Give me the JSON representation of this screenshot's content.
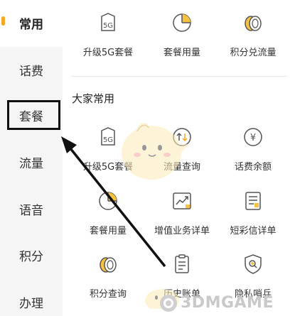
{
  "sidebar": {
    "items": [
      {
        "label": "常用",
        "active": true
      },
      {
        "label": "话费"
      },
      {
        "label": "套餐",
        "highlighted": true
      },
      {
        "label": "流量"
      },
      {
        "label": "语音"
      },
      {
        "label": "积分"
      },
      {
        "label": "办理"
      }
    ],
    "active_color": "#f5a623"
  },
  "top_row": [
    {
      "label": "升级5G套餐",
      "icon": "5g-icon"
    },
    {
      "label": "套餐用量",
      "icon": "pie-chart-icon"
    },
    {
      "label": "积分兑流量",
      "icon": "coins-icon"
    }
  ],
  "section": {
    "title": "大家常用",
    "items": [
      {
        "label": "升级5G套餐",
        "icon": "5g-icon"
      },
      {
        "label": "流量查询",
        "icon": "data-refresh-icon"
      },
      {
        "label": "话费余额",
        "icon": "yen-coin-icon"
      },
      {
        "label": "套餐用量",
        "icon": "pie-chart-icon"
      },
      {
        "label": "增值业务详单",
        "icon": "trend-chart-icon"
      },
      {
        "label": "短彩信详单",
        "icon": "message-list-icon"
      },
      {
        "label": "积分查询",
        "icon": "coins-icon"
      },
      {
        "label": "历史账单",
        "icon": "clipboard-icon"
      },
      {
        "label": "隐私哨兵",
        "icon": "shield-search-icon"
      }
    ]
  },
  "watermark": {
    "text": "3DMGAME"
  }
}
